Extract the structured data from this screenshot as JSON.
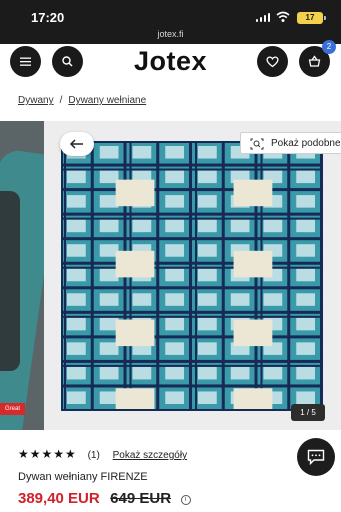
{
  "status_bar": {
    "time": "17:20",
    "url": "jotex.fi",
    "battery": "17"
  },
  "header": {
    "logo": "Jotex",
    "cart_count": "2",
    "icons": [
      "menu-icon",
      "search-icon",
      "heart-icon",
      "basket-icon"
    ]
  },
  "breadcrumb": {
    "items": [
      "Dywany",
      "Dywany wełniane"
    ],
    "separator": "/"
  },
  "gallery": {
    "similar_label": "Pokaż podobne",
    "counter": "1 / 5",
    "prev_badge": "Great"
  },
  "product": {
    "stars": "★★★★★",
    "rating_count": "(1)",
    "details_link": "Pokaż szczegóły",
    "title": "Dywan wełniany FIRENZE",
    "price": "389,40 EUR",
    "old_price": "649 EUR",
    "info_symbol": "i"
  },
  "colors": {
    "rug_teal": "#3a9aaa",
    "rug_navy": "#152a55",
    "rug_light": "#b9dde3",
    "rug_cream": "#ece6d4",
    "price_red": "#d0202a"
  }
}
